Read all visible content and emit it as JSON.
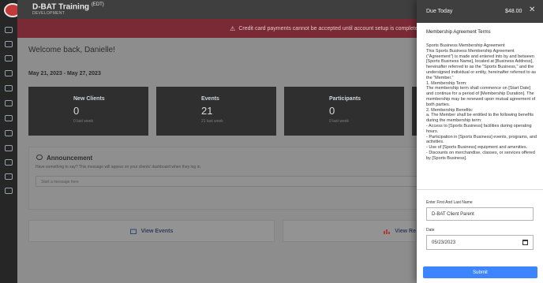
{
  "sidebar": {
    "logo": "dbat-logo",
    "icons": [
      "home-icon",
      "dashboard-icon",
      "calendar-icon",
      "people-icon",
      "clipboard-icon",
      "chart-icon",
      "classroom-icon",
      "card-icon",
      "tag-icon",
      "bullhorn-icon",
      "settings-icon",
      "tools-icon"
    ]
  },
  "header": {
    "org_name": "D-BAT Training",
    "org_tag": "(EDT)",
    "org_sub": "DEVELOPMENT"
  },
  "alert": {
    "text": "Credit card payments cannot be accepted until account setup is complete. Complete account →",
    "color": "#7a2a34"
  },
  "main": {
    "welcome": "Welcome back, Danielle!",
    "date_range": "May 21, 2023 - May 27, 2023",
    "stats": [
      {
        "label": "New Clients",
        "value": "0",
        "sub": "0 last week"
      },
      {
        "label": "Events",
        "value": "21",
        "sub": "21 last week"
      },
      {
        "label": "Participants",
        "value": "0",
        "sub": "0 last week"
      }
    ],
    "announcement": {
      "title": "Announcement",
      "help": "Have something to say? This message will appear on your clients' dashboard when they log in.",
      "placeholder": "Start a message here"
    },
    "actions": [
      {
        "label": "View Events",
        "icon": "calendar-icon"
      },
      {
        "label": "View Re",
        "icon": "bar-chart-icon"
      }
    ]
  },
  "modal": {
    "title": "Due Today",
    "amount": "$48.00",
    "terms_title": "Membership Agreement Terms",
    "terms_text": "Sports Business Membership Agreement\nThis Sports Business Membership Agreement (\"Agreement\") is made and entered into by and between [Sports Business Name], located at [Business Address], hereinafter referred to as the \"Sports Business,\" and the undersigned individual or entity, hereinafter referred to as the \"Member.\"\n1. Membership Term:\n    The membership term shall commence on [Start Date] and continue for a period of [Membership Duration]. The membership may be renewed upon mutual agreement of both parties.\n2. Membership Benefits:\n    a. The Member shall be entitled to the following benefits during the membership term:\n        - Access to [Sports Business] facilities during operating hours.\n        - Participation in [Sports Business] events, programs, and activities.\n        - Use of [Sports Business] equipment and amenities.\n        - Discounts on merchandise, classes, or services offered by [Sports Business].",
    "name_label": "Enter First And Last Name",
    "name_value": "D-BAT Client Parent",
    "date_label": "Date",
    "date_value": "05/23/2023",
    "submit_label": "Submit",
    "accent": "#3d84ff"
  }
}
